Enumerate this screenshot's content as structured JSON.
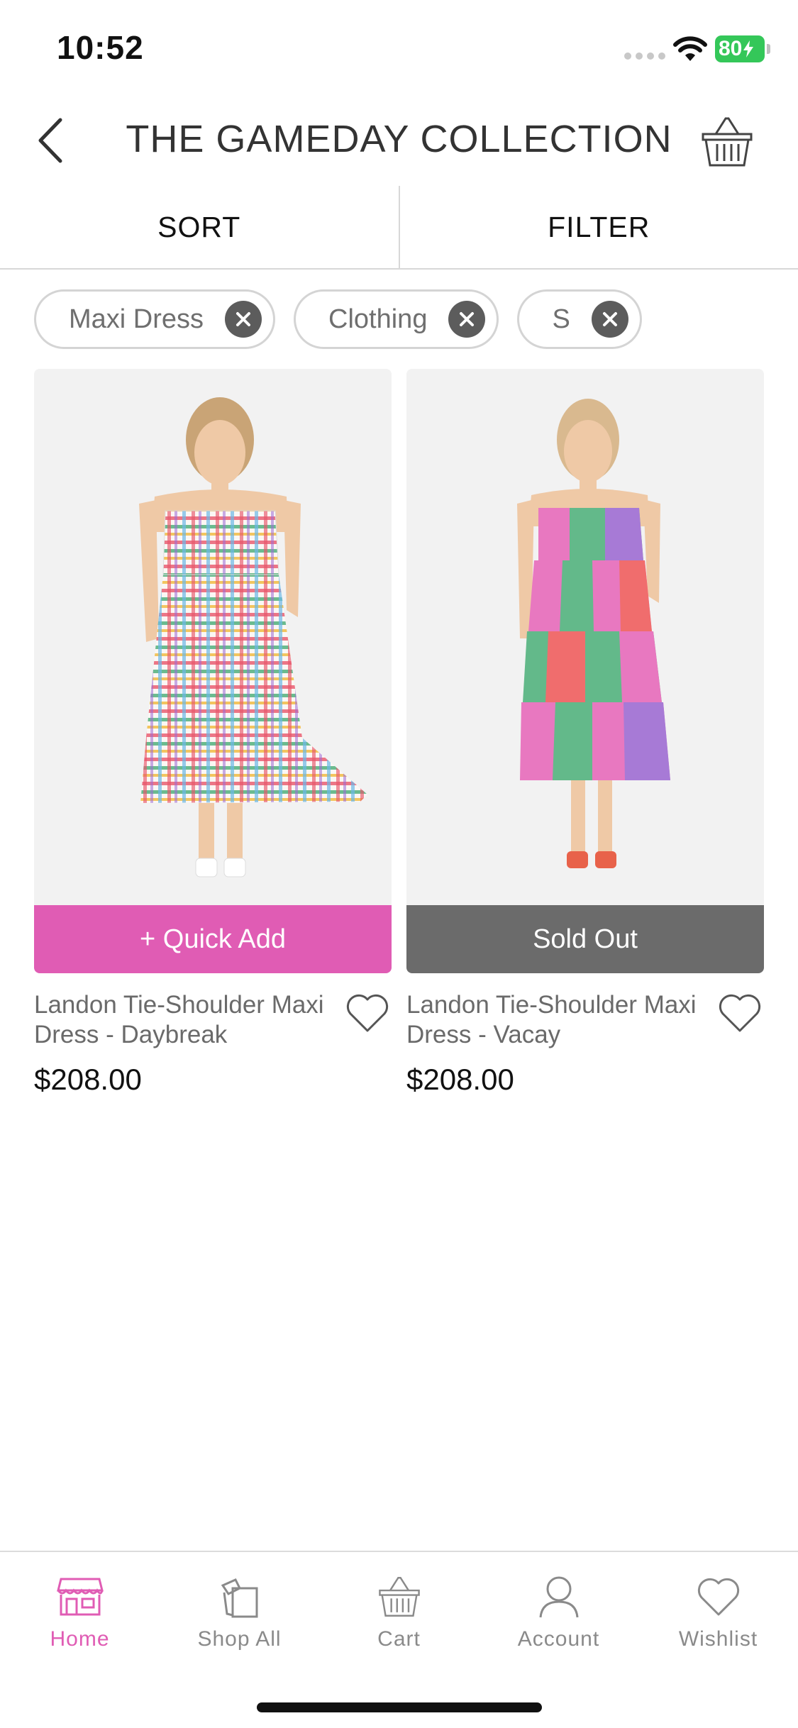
{
  "status": {
    "time": "10:52",
    "battery": "80"
  },
  "header": {
    "title": "THE GAMEDAY COLLECTION"
  },
  "sortbar": {
    "sort_label": "SORT",
    "filter_label": "FILTER"
  },
  "filters": {
    "chips": [
      {
        "label": "Maxi Dress"
      },
      {
        "label": "Clothing"
      },
      {
        "label": "S"
      }
    ]
  },
  "products": [
    {
      "name": "Landon Tie-Shoulder Maxi Dress - Daybreak",
      "price": "$208.00",
      "action": "+ Quick Add",
      "action_color": "#e05cb4"
    },
    {
      "name": "Landon Tie-Shoulder Maxi Dress - Vacay",
      "price": "$208.00",
      "action": "Sold Out",
      "action_color": "#6b6b6b"
    }
  ],
  "tabbar": {
    "accent": "#e05cb4",
    "items": [
      {
        "label": "Home",
        "icon": "storefront-icon",
        "active": true
      },
      {
        "label": "Shop All",
        "icon": "shopping-bags-icon",
        "active": false
      },
      {
        "label": "Cart",
        "icon": "basket-icon",
        "active": false
      },
      {
        "label": "Account",
        "icon": "person-icon",
        "active": false
      },
      {
        "label": "Wishlist",
        "icon": "heart-icon",
        "active": false
      }
    ]
  }
}
